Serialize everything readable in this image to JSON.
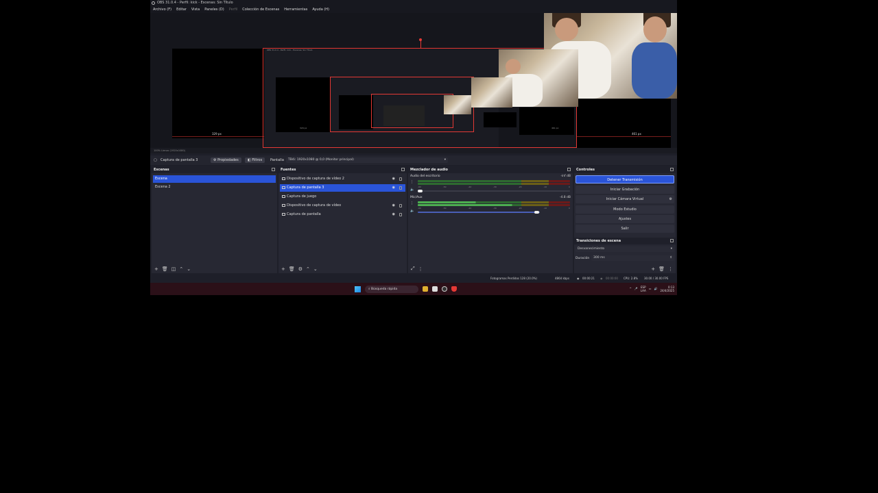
{
  "window": {
    "title": "OBS 31.0.4 - Perfil: kick - Escenas: Sin Título"
  },
  "menu": {
    "items": [
      "Archivo (F)",
      "Editar",
      "Vista",
      "Paneles (D)",
      "Perfil",
      "Colección de Escenas",
      "Herramientas",
      "Ayuda (H)"
    ]
  },
  "preview": {
    "left_px_label": "329 px",
    "right_px_label": "461 px",
    "nested_px_label_1": "329 px",
    "nested_px_label_2": "461 px",
    "zoom_text": "100%   Lienzo (1920x1080)"
  },
  "source_bar": {
    "selected_source": "Captura de pantalla 3",
    "properties": "Propiedades",
    "filters": "Filtros",
    "display_label": "Pantalla",
    "display_value": "TB4i: 1920x1080 @ 0,0 (Monitor principal)"
  },
  "scenes": {
    "title": "Escenas",
    "items": [
      "Escena",
      "Escena 2"
    ],
    "selected_index": 0
  },
  "sources": {
    "title": "Fuentes",
    "items": [
      "Dispositivo de captura de vídeo 2",
      "Captura de pantalla 3",
      "Captura de juego",
      "Dispositivo de captura de vídeo",
      "Captura de pantalla"
    ],
    "selected_index": 1
  },
  "mixer": {
    "title": "Mezclador de audio",
    "channels": [
      {
        "name": "Audio del escritorio",
        "db": "-inf dB",
        "level": 0.0
      },
      {
        "name": "Mic/Aux",
        "db": "-4.8 dB",
        "level": 0.62
      }
    ],
    "ticks": [
      "-60",
      "-55",
      "-50",
      "-45",
      "-40",
      "-35",
      "-30",
      "-25",
      "-20",
      "-15",
      "-10",
      "-5",
      "0"
    ]
  },
  "controls": {
    "title": "Controles",
    "buttons": [
      "Detener Transmisión",
      "Iniciar Grabación",
      "Iniciar Cámara Virtual",
      "Modo Estudio",
      "Ajustes",
      "Salir"
    ]
  },
  "transitions": {
    "title": "Transiciones de escena",
    "type": "Desvanecimiento",
    "duration_label": "Duración",
    "duration_value": "300 ms"
  },
  "status": {
    "dropped": "Fotogramas Perdidos 128 (20.0%)",
    "bitrate": "4864 kbps",
    "stream_time": "00:00:21",
    "rec_time": "00:00:00",
    "cpu": "CPU: 2.8%",
    "fps": "30.00 / 30.00 FPS"
  },
  "taskbar": {
    "search_placeholder": "Búsqueda rápida",
    "lang": "ESP",
    "lang2": "LAA",
    "time": "0:13",
    "date": "24/4/2025"
  },
  "colors": {
    "accent": "#2a54d8",
    "bounding_red": "#e53935",
    "meter_green": "#4caf50",
    "meter_yellow": "#c6b12a",
    "meter_red": "#c62828"
  }
}
